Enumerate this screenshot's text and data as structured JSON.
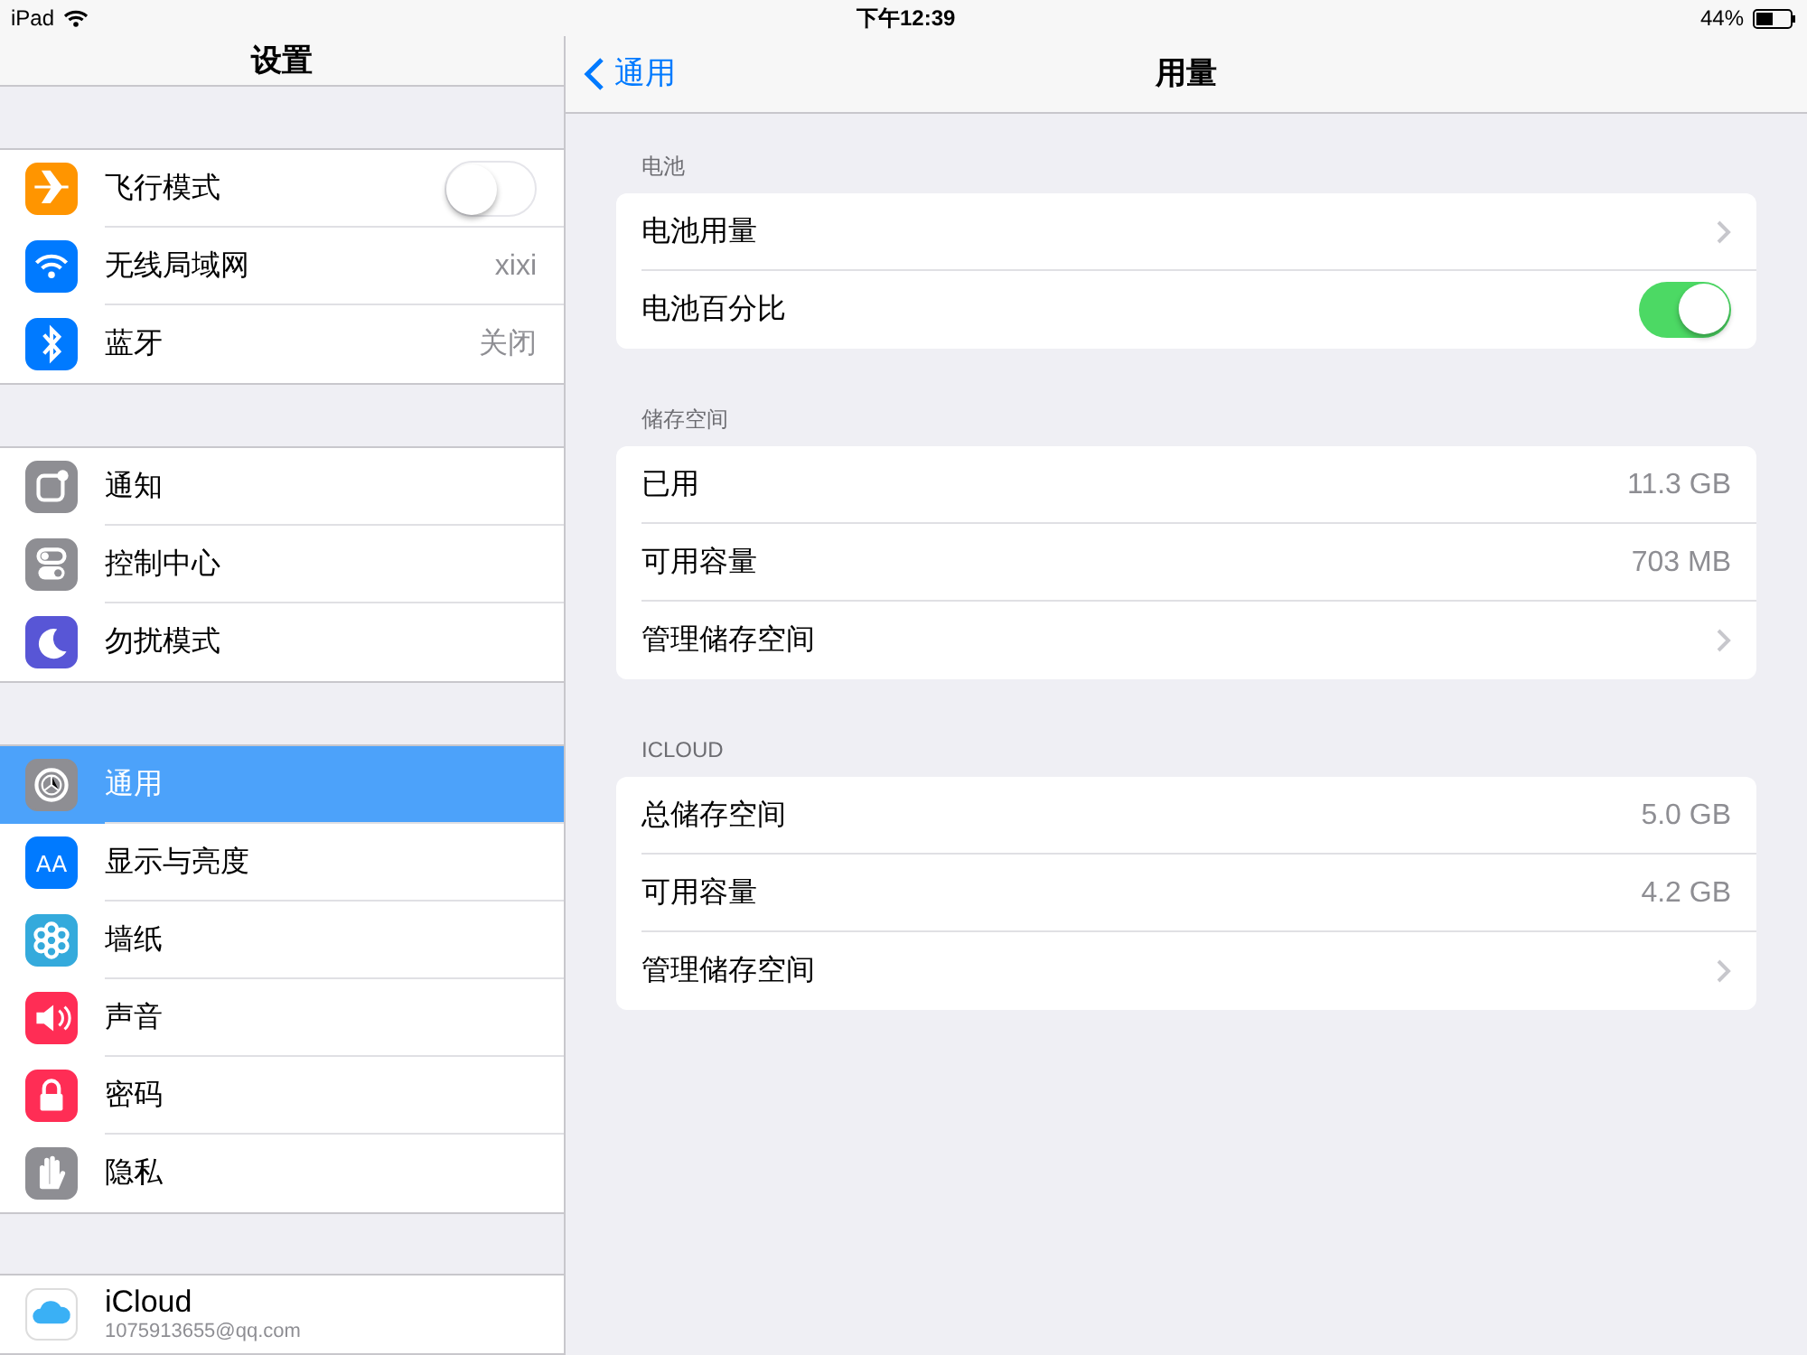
{
  "status_bar": {
    "device": "iPad",
    "time": "下午12:39",
    "battery": "44%"
  },
  "sidebar": {
    "title": "设置",
    "groups": [
      [
        {
          "label": "飞行模式",
          "color": "#ff9500",
          "kind": "toggle",
          "on": false,
          "selected": false
        },
        {
          "label": "无线局域网",
          "color": "#007aff",
          "kind": "value",
          "value": "xixi",
          "selected": false
        },
        {
          "label": "蓝牙",
          "color": "#007aff",
          "kind": "value",
          "value": "关闭",
          "selected": false
        }
      ],
      [
        {
          "label": "通知",
          "color": "#8e8e93",
          "kind": "plain",
          "selected": false
        },
        {
          "label": "控制中心",
          "color": "#8e8e93",
          "kind": "plain",
          "selected": false
        },
        {
          "label": "勿扰模式",
          "color": "#5856d6",
          "kind": "plain",
          "selected": false
        }
      ],
      [
        {
          "label": "通用",
          "color": "#8e8e93",
          "kind": "plain",
          "selected": true
        },
        {
          "label": "显示与亮度",
          "color": "#007aff",
          "kind": "plain",
          "icon_text": "AA",
          "selected": false
        },
        {
          "label": "墙纸",
          "color": "#34aadc",
          "kind": "plain",
          "selected": false
        },
        {
          "label": "声音",
          "color": "#ff2d55",
          "kind": "plain",
          "selected": false
        },
        {
          "label": "密码",
          "color": "#ff2d55",
          "kind": "plain",
          "selected": false
        },
        {
          "label": "隐私",
          "color": "#8e8e93",
          "kind": "plain",
          "selected": false
        }
      ],
      [
        {
          "label": "iCloud",
          "subtitle": "1075913655@qq.com",
          "kind": "account",
          "selected": false
        }
      ]
    ]
  },
  "detail": {
    "back": "通用",
    "title": "用量",
    "sections": [
      {
        "header": "电池",
        "rows": [
          {
            "label": "电池用量",
            "kind": "chevron"
          },
          {
            "label": "电池百分比",
            "kind": "toggle",
            "on": true
          }
        ]
      },
      {
        "header": "储存空间",
        "rows": [
          {
            "label": "已用",
            "kind": "value",
            "value": "11.3 GB"
          },
          {
            "label": "可用容量",
            "kind": "value",
            "value": "703 MB"
          },
          {
            "label": "管理储存空间",
            "kind": "chevron"
          }
        ]
      },
      {
        "header": "ICLOUD",
        "rows": [
          {
            "label": "总储存空间",
            "kind": "value",
            "value": "5.0 GB"
          },
          {
            "label": "可用容量",
            "kind": "value",
            "value": "4.2 GB"
          },
          {
            "label": "管理储存空间",
            "kind": "chevron"
          }
        ]
      }
    ]
  }
}
